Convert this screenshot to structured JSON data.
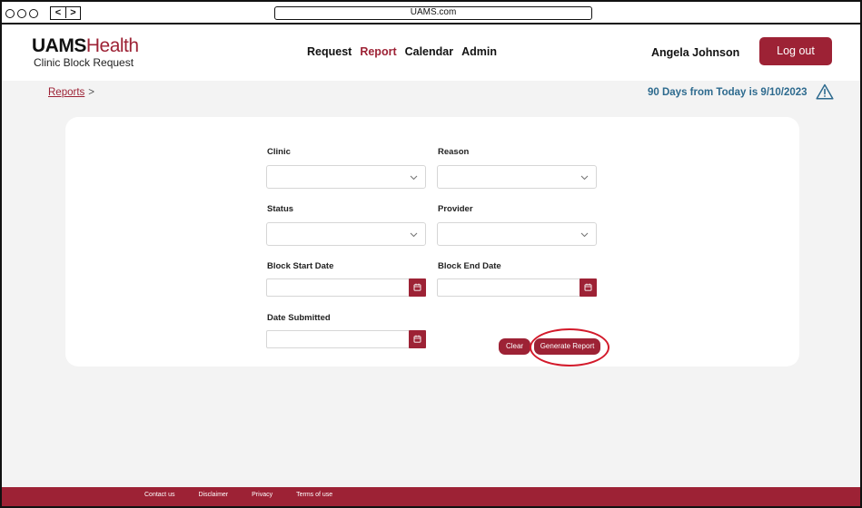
{
  "browser": {
    "back_label": "<",
    "forward_label": ">",
    "url": "UAMS.com"
  },
  "header": {
    "logo_primary": "UAMS",
    "logo_secondary": "Health",
    "app_name": "Clinic Block Request",
    "nav": [
      "Request",
      "Report",
      "Calendar",
      "Admin"
    ],
    "active_nav": "Report",
    "user_name": "Angela Johnson",
    "logout_label": "Log out"
  },
  "breadcrumb": {
    "link": "Reports",
    "separator": ">"
  },
  "notice": "90 Days from Today is 9/10/2023",
  "form": {
    "clinic_label": "Clinic",
    "clinic_value": "",
    "reason_label": "Reason",
    "reason_value": "",
    "status_label": "Status",
    "status_value": "",
    "provider_label": "Provider",
    "provider_value": "",
    "block_start_label": "Block Start Date",
    "block_start_value": "",
    "block_end_label": "Block End Date",
    "block_end_value": "",
    "date_submitted_label": "Date Submitted",
    "date_submitted_value": "",
    "clear_label": "Clear",
    "generate_label": "Generate Report"
  },
  "footer": {
    "links": [
      "Contact us",
      "Disclaimer",
      "Privacy",
      "Terms of use"
    ]
  },
  "colors": {
    "brand": "#9d2235",
    "notice": "#2d6a8e",
    "highlight": "#d31a2b",
    "background": "#f3f3f3"
  }
}
